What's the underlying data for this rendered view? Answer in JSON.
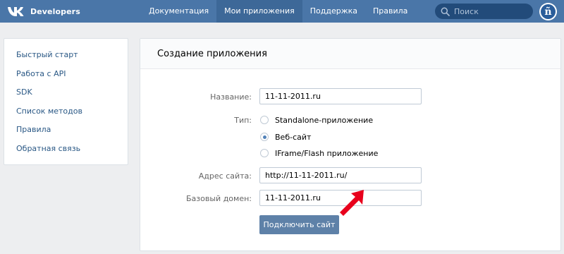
{
  "header": {
    "brand": "Developers",
    "nav": [
      {
        "label": "Документация",
        "active": false
      },
      {
        "label": "Мои приложения",
        "active": true
      },
      {
        "label": "Поддержка",
        "active": false
      },
      {
        "label": "Правила",
        "active": false
      }
    ],
    "search_placeholder": "Поиск",
    "avatar_icon": "user-avatar-icon"
  },
  "sidebar": {
    "items": [
      {
        "label": "Быстрый старт"
      },
      {
        "label": "Работа с API"
      },
      {
        "label": "SDK"
      },
      {
        "label": "Список методов"
      },
      {
        "label": "Правила"
      },
      {
        "label": "Обратная связь"
      }
    ]
  },
  "form": {
    "title": "Создание приложения",
    "name_label": "Название:",
    "name_value": "11-11-2011.ru",
    "type_label": "Тип:",
    "types": [
      {
        "label": "Standalone-приложение",
        "checked": false
      },
      {
        "label": "Веб-сайт",
        "checked": true
      },
      {
        "label": "IFrame/Flash приложение",
        "checked": false
      }
    ],
    "site_label": "Адрес сайта:",
    "site_value": "http://11-11-2011.ru/",
    "domain_label": "Базовый домен:",
    "domain_value": "11-11-2011.ru",
    "submit_label": "Подключить сайт"
  },
  "colors": {
    "header_bg": "#4a76a8",
    "accent": "#5181b8",
    "button_bg": "#5e81a8",
    "arrow": "#e8001c"
  }
}
